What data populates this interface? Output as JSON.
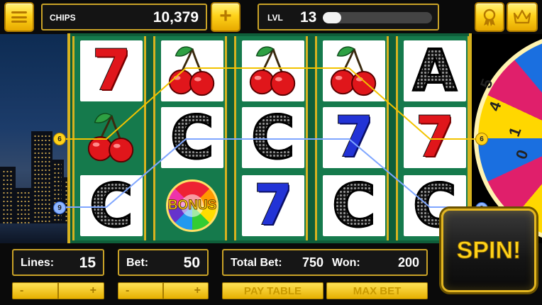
{
  "top": {
    "chips_label": "CHIPS",
    "chips_value": "10,379",
    "plus_glyph": "+",
    "level_label": "LVL",
    "level_value": "13",
    "xp_progress": 0.17
  },
  "icons": {
    "menu": "menu-icon",
    "plus": "plus-icon",
    "trophy": "trophy-icon",
    "crown": "crown-icon"
  },
  "reels": [
    [
      "seven-red",
      "cherries",
      "c-black"
    ],
    [
      "cherries",
      "c-black",
      "bonus"
    ],
    [
      "cherries",
      "c-black",
      "seven-blue"
    ],
    [
      "cherries",
      "seven-blue",
      "c-black"
    ],
    [
      "a-black",
      "seven-red",
      "c-black"
    ]
  ],
  "symbols": {
    "seven": "7",
    "c": "C",
    "a": "A",
    "bonus": "BONUS"
  },
  "paylines": {
    "line_a": "6",
    "line_b": "9"
  },
  "wheel_numbers": [
    "5",
    "4",
    "1",
    "0"
  ],
  "controls": {
    "lines_label": "Lines:",
    "lines_value": "15",
    "bet_label": "Bet:",
    "bet_value": "50",
    "total_bet_label": "Total Bet:",
    "total_bet_value": "750",
    "won_label": "Won:",
    "won_value": "200",
    "minus": "-",
    "plus": "+",
    "pay_table": "PAY TABLE",
    "max_bet": "MAX BET",
    "spin": "SPIN!"
  },
  "colors": {
    "gold": "#ffd21a",
    "reel_green": "#157a4c",
    "red_seven": "#e0161b",
    "blue_seven": "#2233d6",
    "payline_yellow": "#f2c300",
    "payline_blue": "#7fa6ff"
  }
}
